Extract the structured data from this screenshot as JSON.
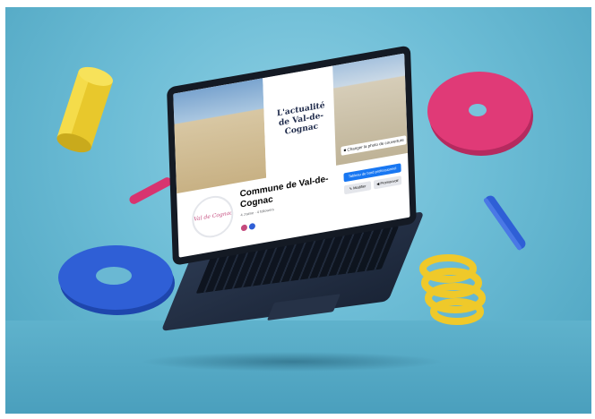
{
  "cover": {
    "title_line1": "L'actualité",
    "title_line2": "de Val-de-Cognac",
    "change_cover_label": "Changer la photo de couverture"
  },
  "page": {
    "name": "Commune de Val-de-Cognac",
    "meta": "4 J'aime · 4 followers",
    "avatar_text": "Val de Cognac"
  },
  "actions": {
    "pro_dashboard_label": "Tableau de bord professionnel",
    "edit_label": "Modifier",
    "promote_label": "Promouvoir"
  },
  "colors": {
    "facebook_blue": "#1877f2",
    "yellow": "#f1d43a",
    "pink": "#e03a77",
    "blue": "#2f5fd6"
  }
}
